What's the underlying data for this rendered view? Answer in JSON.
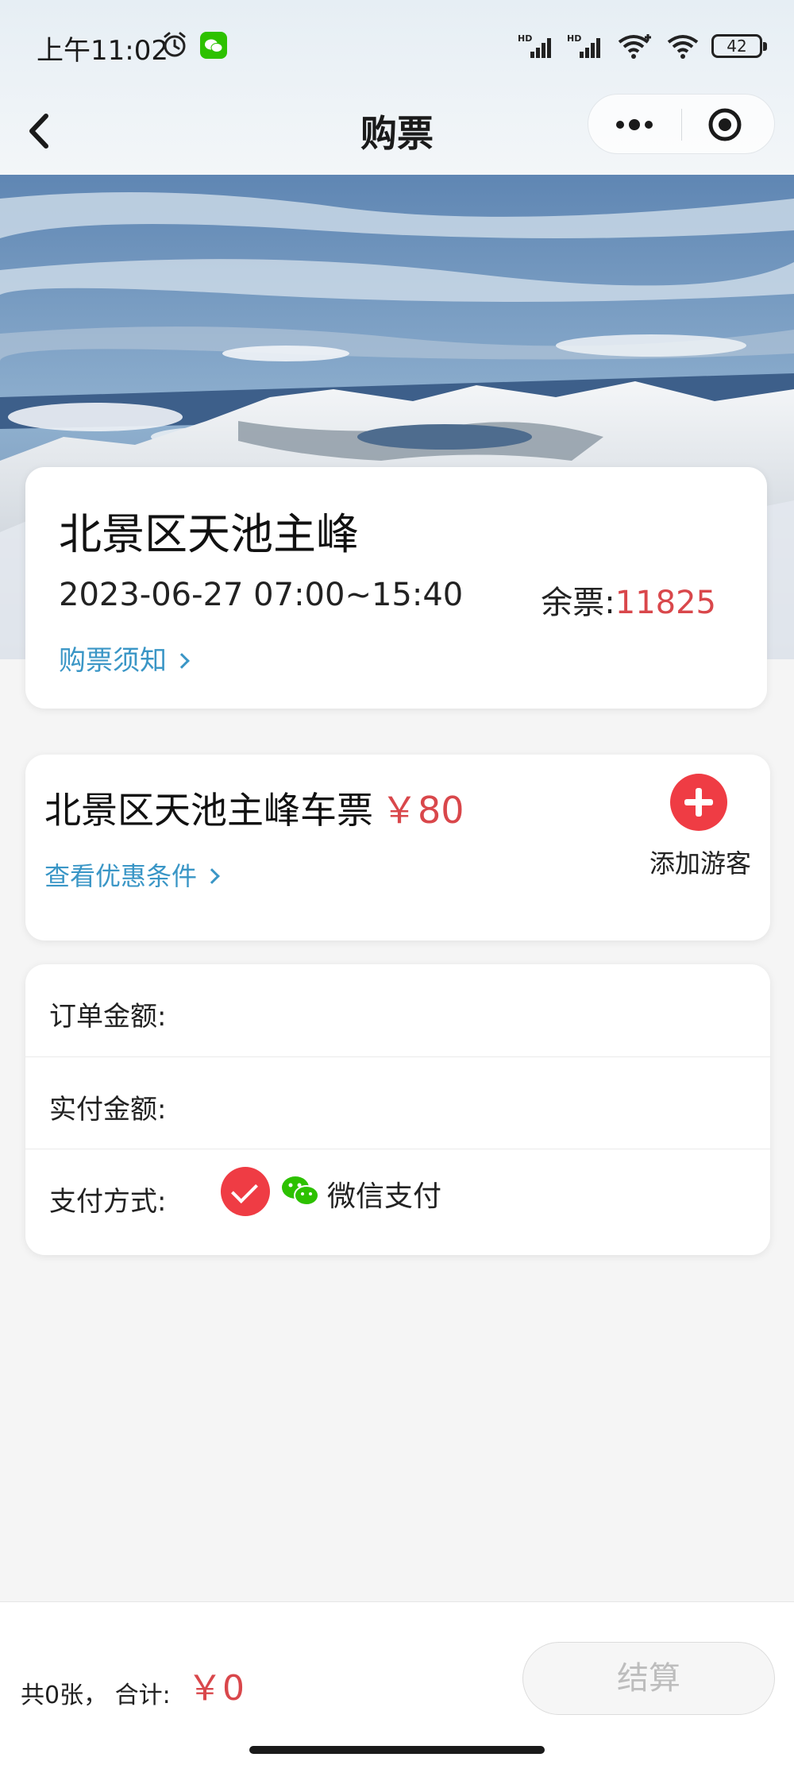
{
  "status_bar": {
    "time": "上午11:02",
    "battery": "42",
    "icons": [
      "alarm-icon",
      "wechat-icon",
      "hd-signal-icon",
      "hd-signal-icon",
      "wifi-plus-icon",
      "wifi-icon",
      "battery-icon"
    ]
  },
  "nav": {
    "title": "购票",
    "icons": [
      "back-chevron-icon",
      "more-dots-icon",
      "target-circle-icon"
    ]
  },
  "scenic": {
    "name": "北景区天池主峰",
    "time_range": "2023-06-27 07:00~15:40",
    "remain_label": "余票:",
    "remain_count": "11825",
    "notice_link": "购票须知"
  },
  "ticket": {
    "name": "北景区天池主峰车票",
    "price": "￥80",
    "discount_link": "查看优惠条件",
    "add_label": "添加游客"
  },
  "payment": {
    "order_amount_label": "订单金额:",
    "paid_amount_label": "实付金额:",
    "method_label": "支付方式:",
    "method_name": "微信支付"
  },
  "footer": {
    "total_text": "共0张， 合计:",
    "total_amount": "￥0",
    "checkout_label": "结算"
  },
  "colors": {
    "accent_red": "#ef3c44",
    "price_red": "#d9474b",
    "link_blue": "#3a96c6",
    "wechat_green": "#2dc100"
  }
}
